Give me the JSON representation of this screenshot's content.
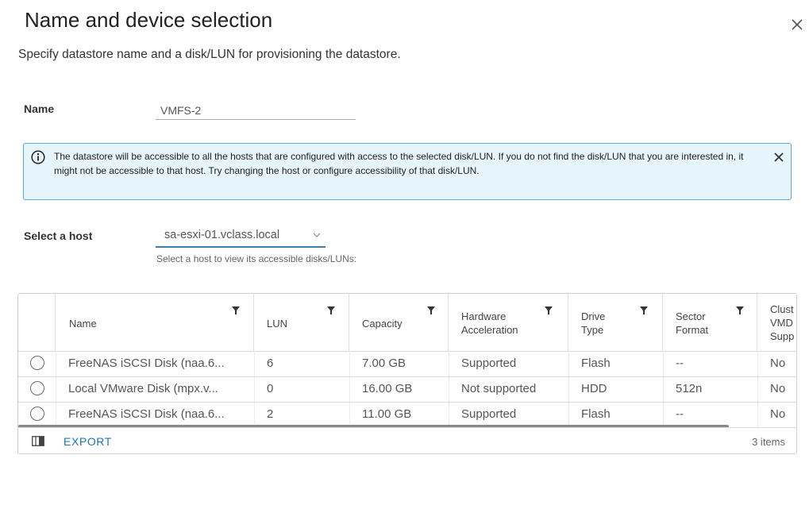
{
  "dialog": {
    "title": "Name and device selection",
    "subtitle": "Specify datastore name and a disk/LUN for provisioning the datastore."
  },
  "name_field": {
    "label": "Name",
    "value": "VMFS-2"
  },
  "info": {
    "text": "The datastore will be accessible to all the hosts that are configured with access to the selected disk/LUN. If you do not find the disk/LUN that you are interested in, it might not be accessible to that host. Try changing the host or configure accessibility of that disk/LUN."
  },
  "host": {
    "label": "Select a host",
    "selected": "sa-esxi-01.vclass.local",
    "hint": "Select a host to view its accessible disks/LUNs:"
  },
  "table": {
    "columns": [
      {
        "label": "Name"
      },
      {
        "label": "LUN"
      },
      {
        "label": "Capacity"
      },
      {
        "label_line1": "Hardware",
        "label_line2": "Acceleration"
      },
      {
        "label_line1": "Drive",
        "label_line2": "Type"
      },
      {
        "label_line1": "Sector",
        "label_line2": "Format"
      },
      {
        "label_line1": "Clust",
        "label_line2": "VMD",
        "label_line3": "Supp"
      }
    ],
    "rows": [
      {
        "name": "FreeNAS iSCSI Disk (naa.6...",
        "lun": "6",
        "capacity": "7.00 GB",
        "hw_accel": "Supported",
        "drive_type": "Flash",
        "sector_format": "--",
        "cluster": "No"
      },
      {
        "name": "Local VMware Disk (mpx.v...",
        "lun": "0",
        "capacity": "16.00 GB",
        "hw_accel": "Not supported",
        "drive_type": "HDD",
        "sector_format": "512n",
        "cluster": "No"
      },
      {
        "name": "FreeNAS iSCSI Disk (naa.6...",
        "lun": "2",
        "capacity": "11.00 GB",
        "hw_accel": "Supported",
        "drive_type": "Flash",
        "sector_format": "--",
        "cluster": "No"
      }
    ],
    "export_label": "EXPORT",
    "item_count": "3 items"
  },
  "colors": {
    "accent": "#1b75bb",
    "info_border": "#5ca7d1",
    "info_bg": "#e6f4fb"
  },
  "icons": [
    "close-icon",
    "info-icon",
    "chevron-down-icon",
    "filter-icon",
    "column-toggle-icon"
  ]
}
